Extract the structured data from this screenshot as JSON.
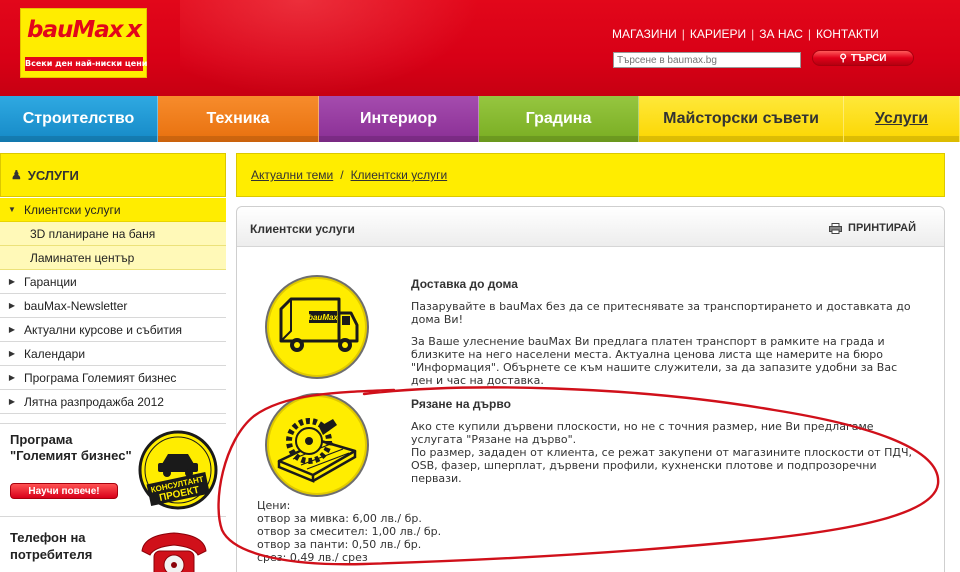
{
  "header": {
    "logo_word": "bauMax",
    "logo_x": "x",
    "slogan": "Всеки ден най-ниски цени",
    "topnav": [
      "МАГАЗИНИ",
      "КАРИЕРИ",
      "ЗА НАС",
      "КОНТАКТИ"
    ],
    "search_placeholder": "Търсене в baumax.bg",
    "search_button": "ТЪРСИ"
  },
  "categories": [
    "Строителство",
    "Техника",
    "Интериор",
    "Градина",
    "Майсторски съвети",
    "Услуги"
  ],
  "sidebar": {
    "title": "УСЛУГИ",
    "items": [
      {
        "label": "Клиентски услуги",
        "state": "open"
      },
      {
        "label": "3D планиране на баня",
        "state": "sub"
      },
      {
        "label": "Ламинатен център",
        "state": "sub"
      },
      {
        "label": "Гаранции",
        "state": "closed"
      },
      {
        "label": "bauMax-Newsletter",
        "state": "closed"
      },
      {
        "label": "Актуални курсове и събития",
        "state": "closed"
      },
      {
        "label": "Календари",
        "state": "closed"
      },
      {
        "label": "Програма Големият бизнес",
        "state": "closed"
      },
      {
        "label": "Лятна разпродажба 2012",
        "state": "closed"
      }
    ],
    "promo_program": {
      "title": "Програма\n\"Големият бизнес\"",
      "button": "Научи повече!",
      "badge_line1": "КОНСУЛТАНТ",
      "badge_line2": "ПРОЕКТ"
    },
    "promo_phone": {
      "title": "Телефон на\nпотребителя"
    }
  },
  "breadcrumb": [
    "Актуални теми",
    "/",
    "Клиентски услуги"
  ],
  "content": {
    "title": "Клиентски услуги",
    "print": "ПРИНТИРАЙ",
    "delivery": {
      "title": "Доставка до дома",
      "truck_logo": "bauMax",
      "lines1": [
        "Пазарувайте в bauMax без да се притеснявате за транспортирането и доставката до",
        "дома Ви!"
      ],
      "lines2": [
        "За Ваше улеснение bauMax Ви предлага платен транспорт в рамките на града и",
        "близките на него населени места. Актуална ценова листа ще намерите на бюро",
        "\"Информация\". Обърнете се към нашите служители, за да запазите удобни за Вас",
        "ден и час на доставка."
      ]
    },
    "cutting": {
      "title": "Рязане на дърво",
      "lines1": [
        "Ако сте купили дървени плоскости, но не с точния размер, ние Ви предлагаме",
        "услугата \"Рязане на дърво\"."
      ],
      "lines2": [
        "По размер, зададен от клиента, се режат закупени от магазините плоскости от ПДЧ,",
        "OSB, фазер, шперплат, дървени профили, кухненски плотове и подпрозоречни",
        "первази."
      ],
      "prices": [
        "Цени:",
        "отвор за мивка: 6,00 лв./ бр.",
        "отвор за смесител: 1,00 лв./ бр.",
        "отвор за панти: 0,50 лв./ бр.",
        "срез: 0,49 лв./ срез"
      ]
    }
  },
  "colors": {
    "red": "#e2071a",
    "yellow": "#ffed00",
    "blue": "#1589c6",
    "orange": "#e8700e",
    "purple": "#8a2f95",
    "green": "#79ad22"
  },
  "icons": [
    "person-icon",
    "arrow-icon",
    "printer-icon",
    "truck-icon",
    "saw-icon",
    "car-badge-icon",
    "phone-icon",
    "magnifier-icon"
  ]
}
